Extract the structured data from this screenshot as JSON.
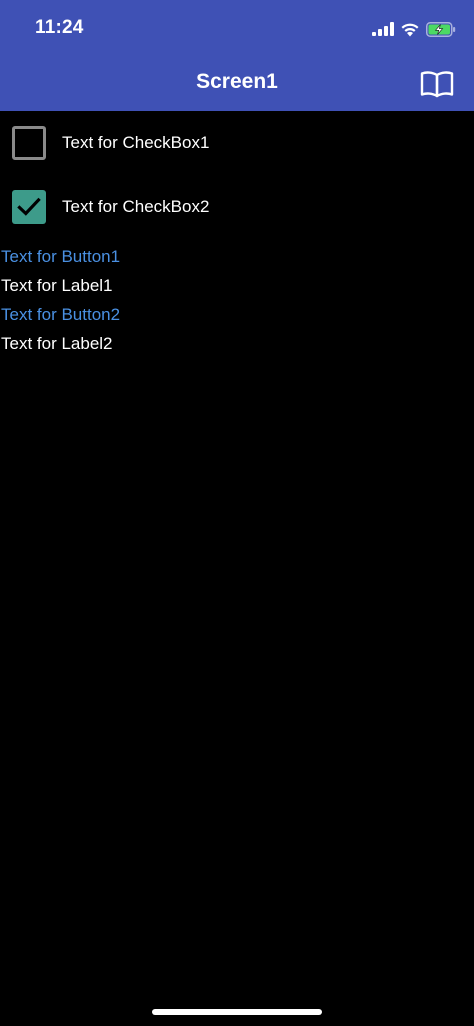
{
  "status_bar": {
    "time": "11:24",
    "icons": [
      "signal-icon",
      "wifi-icon",
      "battery-charging-icon"
    ]
  },
  "app_bar": {
    "title": "Screen1",
    "action_icon": "book-icon",
    "background_color": "#3f51b5"
  },
  "checkboxes": [
    {
      "label": "Text for CheckBox1",
      "checked": false
    },
    {
      "label": "Text for CheckBox2",
      "checked": true,
      "check_color": "#3d9b8a"
    }
  ],
  "buttons": [
    {
      "label": "Text for Button1",
      "color": "#4a90e2"
    },
    {
      "label": "Text for Button2",
      "color": "#4a90e2"
    }
  ],
  "labels": [
    {
      "text": "Text for Label1"
    },
    {
      "text": "Text for Label2"
    }
  ]
}
